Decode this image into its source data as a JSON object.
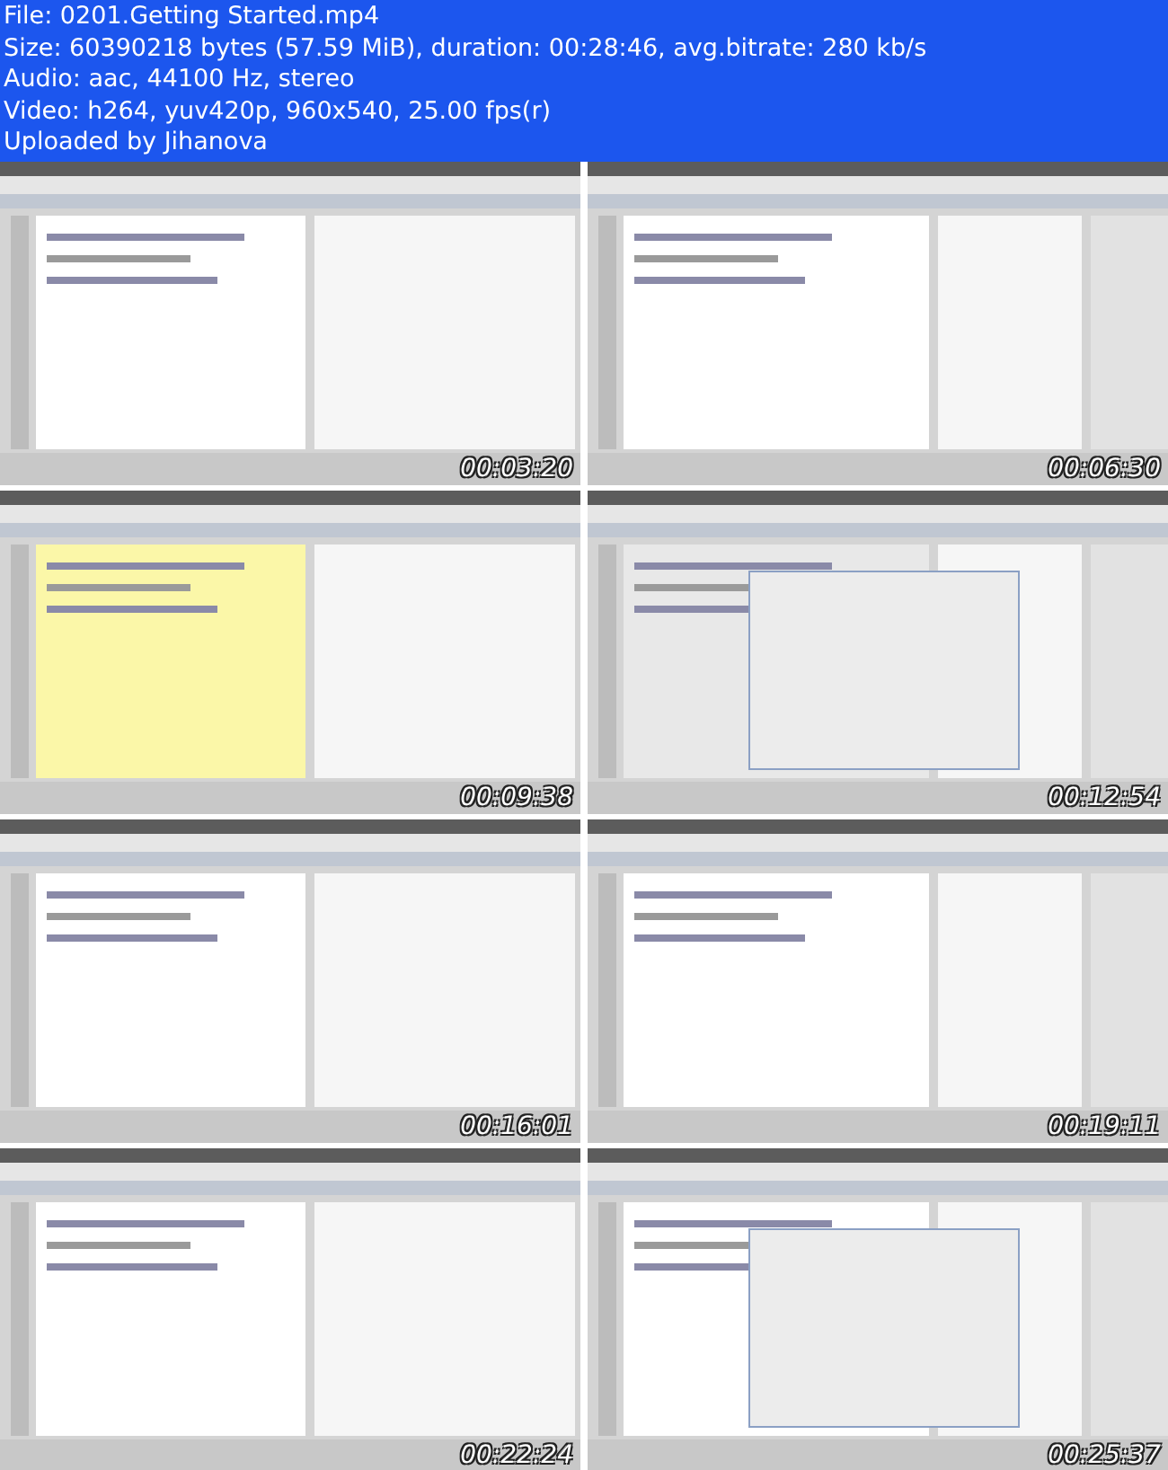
{
  "header": {
    "lines": [
      "File: 0201.Getting Started.mp4",
      "Size: 60390218 bytes (57.59 MiB), duration: 00:28:46, avg.bitrate: 280 kb/s",
      "Audio: aac, 44100 Hz, stereo",
      "Video: h264, yuv420p, 960x540, 25.00 fps(r)",
      "Uploaded by Jihanova"
    ]
  },
  "frames": [
    {
      "kind": "picture",
      "timestamp": "00:03:20"
    },
    {
      "kind": "picture",
      "timestamp": "00:06:30"
    },
    {
      "kind": "picture",
      "timestamp": "00:09:38"
    },
    {
      "kind": "picture",
      "timestamp": "00:12:54"
    },
    {
      "kind": "picture",
      "timestamp": "00:16:01"
    },
    {
      "kind": "picture",
      "timestamp": "00:19:11"
    },
    {
      "kind": "picture",
      "timestamp": "00:22:24"
    },
    {
      "kind": "picture",
      "timestamp": "00:25:37"
    }
  ]
}
